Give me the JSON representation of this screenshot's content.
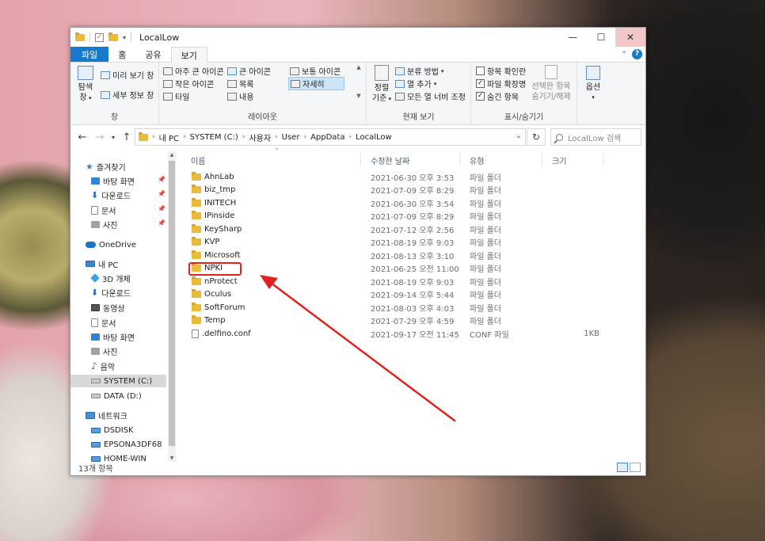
{
  "window": {
    "title": "LocalLow",
    "minimize": "—",
    "maximize": "☐",
    "close": "✕"
  },
  "ribbon_tabs": [
    "파일",
    "홈",
    "공유",
    "보기"
  ],
  "ribbon": {
    "pane": {
      "nav_pane_label_1": "탐색",
      "nav_pane_label_2": "창",
      "preview": "미리 보기 창",
      "details": "세부 정보 창",
      "group_label": "창"
    },
    "layout": {
      "items": [
        "아주 큰 아이콘",
        "큰 아이콘",
        "보통 아이콘",
        "작은 아이콘",
        "목록",
        "자세히",
        "타일",
        "내용"
      ],
      "group_label": "레이아웃"
    },
    "current_view": {
      "sort_label_1": "정렬",
      "sort_label_2": "기준",
      "group_by": "분류 방법",
      "add_columns": "열 추가",
      "fit_columns": "모든 열 너비 조정",
      "group_label": "현재 보기"
    },
    "show_hide": {
      "item_checkboxes": "항목 확인란",
      "file_extensions": "파일 확장명",
      "hidden_items": "숨긴 항목",
      "hide_selected_1": "선택한 항목",
      "hide_selected_2": "숨기기/해제",
      "group_label": "표시/숨기기"
    },
    "options": "옵션"
  },
  "address": {
    "crumbs": [
      "내 PC",
      "SYSTEM (C:)",
      "사용자",
      "User",
      "AppData",
      "LocalLow"
    ]
  },
  "search": {
    "placeholder": "LocalLow 검색"
  },
  "nav_pane": {
    "quick_access": "즐겨찾기",
    "quick_items": [
      "바탕 화면",
      "다운로드",
      "문서",
      "사진"
    ],
    "onedrive": "OneDrive",
    "this_pc": "내 PC",
    "pc_items": [
      "3D 개체",
      "다운로드",
      "동영상",
      "문서",
      "바탕 화면",
      "사진",
      "음악",
      "SYSTEM (C:)",
      "DATA (D:)"
    ],
    "network": "네트워크",
    "network_items": [
      "DSDISK",
      "EPSONA3DF68",
      "HOME-WIN"
    ]
  },
  "columns": [
    "이름",
    "수정한 날짜",
    "유형",
    "크기"
  ],
  "files": [
    {
      "name": "AhnLab",
      "date": "2021-06-30 오후 3:53",
      "type": "파일 폴더",
      "size": "",
      "kind": "folder"
    },
    {
      "name": "biz_tmp",
      "date": "2021-07-09 오후 8:29",
      "type": "파일 폴더",
      "size": "",
      "kind": "folder"
    },
    {
      "name": "INITECH",
      "date": "2021-06-30 오후 3:54",
      "type": "파일 폴더",
      "size": "",
      "kind": "folder"
    },
    {
      "name": "IPinside",
      "date": "2021-07-09 오후 8:29",
      "type": "파일 폴더",
      "size": "",
      "kind": "folder"
    },
    {
      "name": "KeySharp",
      "date": "2021-07-12 오후 2:56",
      "type": "파일 폴더",
      "size": "",
      "kind": "folder"
    },
    {
      "name": "KVP",
      "date": "2021-08-19 오후 9:03",
      "type": "파일 폴더",
      "size": "",
      "kind": "folder"
    },
    {
      "name": "Microsoft",
      "date": "2021-08-13 오후 3:10",
      "type": "파일 폴더",
      "size": "",
      "kind": "folder"
    },
    {
      "name": "NPKI",
      "date": "2021-06-25 오전 11:00",
      "type": "파일 폴더",
      "size": "",
      "kind": "folder"
    },
    {
      "name": "nProtect",
      "date": "2021-08-19 오후 9:03",
      "type": "파일 폴더",
      "size": "",
      "kind": "folder"
    },
    {
      "name": "Oculus",
      "date": "2021-09-14 오후 5:44",
      "type": "파일 폴더",
      "size": "",
      "kind": "folder"
    },
    {
      "name": "SoftForum",
      "date": "2021-08-03 오후 4:03",
      "type": "파일 폴더",
      "size": "",
      "kind": "folder"
    },
    {
      "name": "Temp",
      "date": "2021-07-29 오후 4:59",
      "type": "파일 폴더",
      "size": "",
      "kind": "folder"
    },
    {
      "name": ".delfino.conf",
      "date": "2021-09-17 오전 11:45",
      "type": "CONF 파일",
      "size": "1KB",
      "kind": "file"
    }
  ],
  "status": {
    "count": "13개 항목"
  },
  "colors": {
    "accent": "#1979ca",
    "highlight": "#e0221f",
    "folder": "#e9bb3c"
  }
}
